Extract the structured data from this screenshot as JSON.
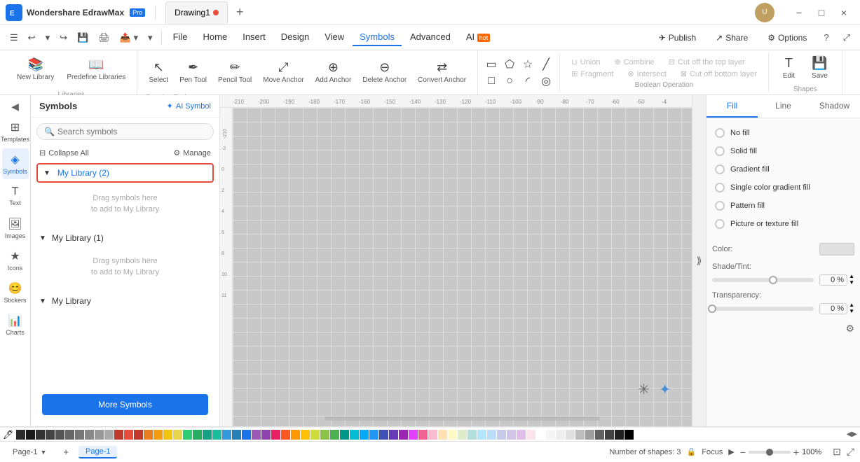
{
  "app": {
    "name": "Wondershare EdrawMax",
    "pro_badge": "Pro",
    "tab1": "Drawing1",
    "favicon": "📐"
  },
  "titlebar": {
    "min": "−",
    "max": "□",
    "close": "×"
  },
  "menubar": {
    "file": "File",
    "home": "Home",
    "insert": "Insert",
    "design": "Design",
    "view": "View",
    "symbols": "Symbols",
    "advanced": "Advanced",
    "ai": "AI",
    "hot": "hot",
    "publish": "Publish",
    "share": "Share",
    "options": "Options"
  },
  "toolbar": {
    "libraries_label": "Libraries",
    "new_library": "New Library",
    "predefine_libraries": "Predefine Libraries",
    "select": "Select",
    "pen_tool": "Pen Tool",
    "pencil_tool": "Pencil Tool",
    "move_anchor": "Move Anchor",
    "add_anchor": "Add Anchor",
    "delete_anchor": "Delete Anchor",
    "convert_anchor": "Convert Anchor",
    "drawing_tools_label": "Drawing Tools",
    "union": "Union",
    "combine": "Combine",
    "cut_off_top": "Cut off the top layer",
    "fragment": "Fragment",
    "intersect": "Intersect",
    "cut_off_bottom": "Cut off bottom layer",
    "bool_label": "Boolean Operation",
    "edit": "Edit",
    "save": "Save",
    "shapes_label": "Shapes"
  },
  "sidebar": {
    "collapse": "◀",
    "templates": "Templates",
    "symbols": "Symbols",
    "text": "Text",
    "images": "Images",
    "icons": "Icons",
    "stickers": "Stickers",
    "charts": "Charts"
  },
  "symbols_panel": {
    "title": "Symbols",
    "ai_symbol": "AI Symbol",
    "search_placeholder": "Search symbols",
    "collapse_all": "Collapse All",
    "manage": "Manage",
    "library1_name": "My Library (2)",
    "library1_drag_hint": "Drag symbols here\nto add to My Library",
    "library2_name": "My Library (1)",
    "library2_drag_hint": "Drag symbols here\nto add to My Library",
    "library3_name": "My Library",
    "more_symbols": "More Symbols"
  },
  "right_panel": {
    "fill_tab": "Fill",
    "line_tab": "Line",
    "shadow_tab": "Shadow",
    "no_fill": "No fill",
    "solid_fill": "Solid fill",
    "gradient_fill": "Gradient fill",
    "single_color_gradient": "Single color gradient fill",
    "pattern_fill": "Pattern fill",
    "picture_texture": "Picture or texture fill",
    "color_label": "Color:",
    "shade_tint_label": "Shade/Tint:",
    "shade_percent": "0 %",
    "transparency_label": "Transparency:",
    "transparency_percent": "0 %"
  },
  "bottom_bar": {
    "page_label": "Page-1",
    "add_page": "+",
    "active_page": "Page-1",
    "shapes_count": "Number of shapes: 3",
    "focus": "Focus",
    "zoom_out": "−",
    "zoom_in": "+",
    "zoom_level": "100%",
    "fit_page": "⊡"
  },
  "colors": [
    "#c0392b",
    "#e74c3c",
    "#e67e22",
    "#f39c12",
    "#f1c40f",
    "#2ecc71",
    "#27ae60",
    "#1abc9c",
    "#16a085",
    "#3498db",
    "#2980b9",
    "#9b59b6",
    "#8e44ad",
    "#34495e",
    "#2c3e50",
    "#ecf0f1",
    "#bdc3c7",
    "#95a5a6",
    "#7f8c8d",
    "#ffffff",
    "#000000"
  ]
}
